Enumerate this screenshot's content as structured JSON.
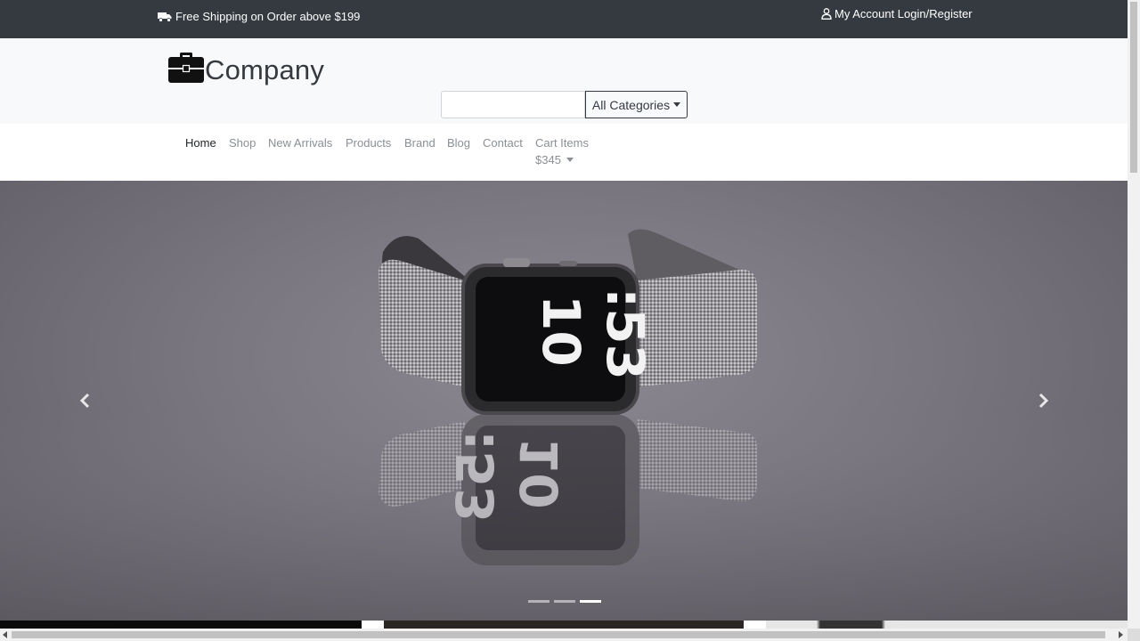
{
  "topbar": {
    "shipping_icon": "truck-icon",
    "shipping_text": "Free Shipping on Order above $199",
    "account_icon": "user-icon",
    "account_text": "My Account Login/Register"
  },
  "brand": {
    "logo_icon": "briefcase-icon",
    "name": "Company"
  },
  "search": {
    "value": "",
    "placeholder": "",
    "category_label": "All Categories"
  },
  "nav": {
    "home": "Home",
    "shop": "Shop",
    "new_arrivals": "New Arrivals",
    "products": "Products",
    "brand": "Brand",
    "blog": "Blog",
    "contact": "Contact",
    "cart_label": "Cart Items",
    "cart_amount": "$345"
  },
  "carousel": {
    "slide_count": 3,
    "active_slide": 3,
    "watch_time_hours": "10",
    "watch_time_minutes": ":53",
    "prev_icon": "chevron-left-icon",
    "next_icon": "chevron-right-icon"
  },
  "colors": {
    "topbar_bg": "#343a40",
    "brand_bg": "#f8f9fa",
    "nav_active": "#212529",
    "nav_inactive": "#8a8f94"
  }
}
